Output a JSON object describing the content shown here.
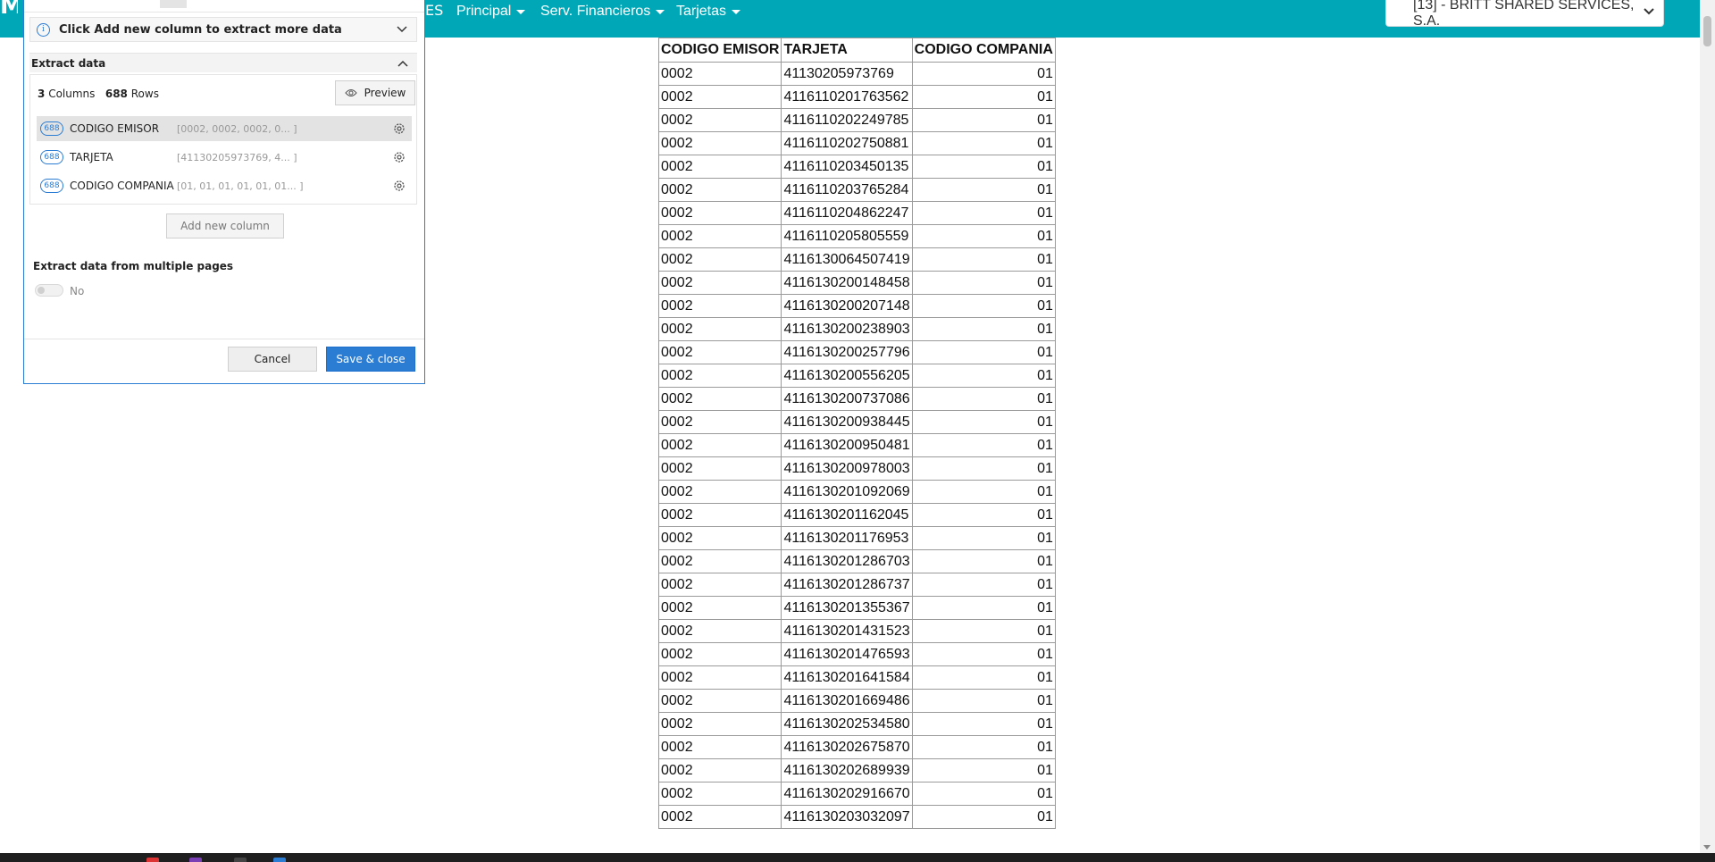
{
  "nav": {
    "fragment": "ES",
    "items": [
      {
        "label": "Principal"
      },
      {
        "label": "Serv. Financieros"
      },
      {
        "label": "Tarjetas"
      }
    ],
    "company": "[13] - BRITT SHARED SERVICES, S.A."
  },
  "panel": {
    "info_text": "Click Add new column to extract more data",
    "section_title": "Extract data",
    "columns_count": "3",
    "columns_word": "Columns",
    "rows_count": "688",
    "rows_word": "Rows",
    "preview_label": "Preview",
    "columns": [
      {
        "badge": "688",
        "name": "CODIGO EMISOR",
        "preview": "[0002, 0002, 0002, 0... ]",
        "selected": true
      },
      {
        "badge": "688",
        "name": "TARJETA",
        "preview": "[41130205973769, 4... ]",
        "selected": false
      },
      {
        "badge": "688",
        "name": "CODIGO COMPANIA",
        "preview": "[01, 01, 01, 01, 01, 01... ]",
        "selected": false
      }
    ],
    "add_column_label": "Add new column",
    "multi_page_label": "Extract data from multiple pages",
    "toggle_label": "No",
    "cancel_label": "Cancel",
    "save_label": "Save & close"
  },
  "table": {
    "headers": [
      "CODIGO EMISOR",
      "TARJETA",
      "CODIGO COMPANIA"
    ],
    "rows": [
      [
        "0002",
        "41130205973769",
        "01"
      ],
      [
        "0002",
        "4116110201763562",
        "01"
      ],
      [
        "0002",
        "4116110202249785",
        "01"
      ],
      [
        "0002",
        "4116110202750881",
        "01"
      ],
      [
        "0002",
        "4116110203450135",
        "01"
      ],
      [
        "0002",
        "4116110203765284",
        "01"
      ],
      [
        "0002",
        "4116110204862247",
        "01"
      ],
      [
        "0002",
        "4116110205805559",
        "01"
      ],
      [
        "0002",
        "4116130064507419",
        "01"
      ],
      [
        "0002",
        "4116130200148458",
        "01"
      ],
      [
        "0002",
        "4116130200207148",
        "01"
      ],
      [
        "0002",
        "4116130200238903",
        "01"
      ],
      [
        "0002",
        "4116130200257796",
        "01"
      ],
      [
        "0002",
        "4116130200556205",
        "01"
      ],
      [
        "0002",
        "4116130200737086",
        "01"
      ],
      [
        "0002",
        "4116130200938445",
        "01"
      ],
      [
        "0002",
        "4116130200950481",
        "01"
      ],
      [
        "0002",
        "4116130200978003",
        "01"
      ],
      [
        "0002",
        "4116130201092069",
        "01"
      ],
      [
        "0002",
        "4116130201162045",
        "01"
      ],
      [
        "0002",
        "4116130201176953",
        "01"
      ],
      [
        "0002",
        "4116130201286703",
        "01"
      ],
      [
        "0002",
        "4116130201286737",
        "01"
      ],
      [
        "0002",
        "4116130201355367",
        "01"
      ],
      [
        "0002",
        "4116130201431523",
        "01"
      ],
      [
        "0002",
        "4116130201476593",
        "01"
      ],
      [
        "0002",
        "4116130201641584",
        "01"
      ],
      [
        "0002",
        "4116130201669486",
        "01"
      ],
      [
        "0002",
        "4116130202534580",
        "01"
      ],
      [
        "0002",
        "4116130202675870",
        "01"
      ],
      [
        "0002",
        "4116130202689939",
        "01"
      ],
      [
        "0002",
        "4116130202916670",
        "01"
      ],
      [
        "0002",
        "4116130203032097",
        "01"
      ]
    ]
  },
  "colors": {
    "nav_bg": "#00a7b7",
    "accent": "#2b7cd3"
  }
}
